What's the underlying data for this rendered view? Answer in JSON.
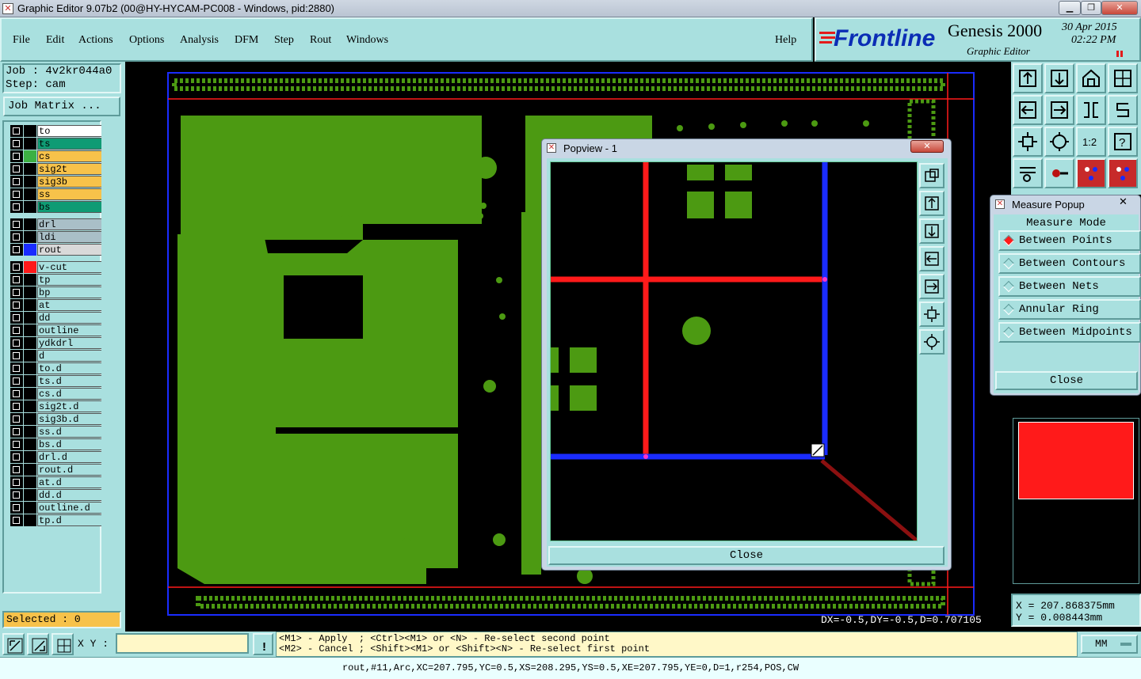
{
  "window": {
    "title": "Graphic Editor 9.07b2 (00@HY-HYCAM-PC008 - Windows, pid:2880)"
  },
  "menu": {
    "file": "File",
    "edit": "Edit",
    "actions": "Actions",
    "options": "Options",
    "analysis": "Analysis",
    "dfm": "DFM",
    "step": "Step",
    "rout": "Rout",
    "windows": "Windows",
    "help": "Help"
  },
  "brand": {
    "logo": "Frontline",
    "product": "Genesis 2000",
    "subtitle": "Graphic Editor",
    "date": "30 Apr 2015",
    "time": "02:22 PM"
  },
  "job": {
    "job_label": "Job : 4v2kr044a0",
    "step_label": "Step: cam",
    "matrix_button": "Job Matrix ..."
  },
  "layers": [
    {
      "name": "to",
      "bg": "#ffffff",
      "swatch": "#000000"
    },
    {
      "name": "ts",
      "bg": "#0f9b74",
      "swatch": "#000000"
    },
    {
      "name": "cs",
      "bg": "#f7c24a",
      "swatch": "#3cb043"
    },
    {
      "name": "sig2t",
      "bg": "#f7c24a",
      "swatch": "#000000"
    },
    {
      "name": "sig3b",
      "bg": "#f7c24a",
      "swatch": "#000000"
    },
    {
      "name": "ss",
      "bg": "#f7c24a",
      "swatch": "#000000"
    },
    {
      "name": "bs",
      "bg": "#0f9b74",
      "swatch": "#000000"
    },
    {
      "name": "drl",
      "bg": "#a9bfc7",
      "swatch": "#000000"
    },
    {
      "name": "ldi",
      "bg": "#a9bfc7",
      "swatch": "#000000"
    },
    {
      "name": "rout",
      "bg": "#d9d9d9",
      "swatch": "#1a2cff"
    },
    {
      "name": "v-cut",
      "bg": "#a9e0df",
      "swatch": "#ff1a1a"
    },
    {
      "name": "tp",
      "bg": "#a9e0df",
      "swatch": "#000000"
    },
    {
      "name": "bp",
      "bg": "#a9e0df",
      "swatch": "#000000"
    },
    {
      "name": "at",
      "bg": "#a9e0df",
      "swatch": "#000000"
    },
    {
      "name": "dd",
      "bg": "#a9e0df",
      "swatch": "#000000"
    },
    {
      "name": "outline",
      "bg": "#a9e0df",
      "swatch": "#000000"
    },
    {
      "name": "ydkdrl",
      "bg": "#a9e0df",
      "swatch": "#000000"
    },
    {
      "name": "d",
      "bg": "#a9e0df",
      "swatch": "#000000"
    },
    {
      "name": "to.d",
      "bg": "#a9e0df",
      "swatch": "#000000"
    },
    {
      "name": "ts.d",
      "bg": "#a9e0df",
      "swatch": "#000000"
    },
    {
      "name": "cs.d",
      "bg": "#a9e0df",
      "swatch": "#000000"
    },
    {
      "name": "sig2t.d",
      "bg": "#a9e0df",
      "swatch": "#000000"
    },
    {
      "name": "sig3b.d",
      "bg": "#a9e0df",
      "swatch": "#000000"
    },
    {
      "name": "ss.d",
      "bg": "#a9e0df",
      "swatch": "#000000"
    },
    {
      "name": "bs.d",
      "bg": "#a9e0df",
      "swatch": "#000000"
    },
    {
      "name": "drl.d",
      "bg": "#a9e0df",
      "swatch": "#000000"
    },
    {
      "name": "rout.d",
      "bg": "#a9e0df",
      "swatch": "#000000"
    },
    {
      "name": "at.d",
      "bg": "#a9e0df",
      "swatch": "#000000"
    },
    {
      "name": "dd.d",
      "bg": "#a9e0df",
      "swatch": "#000000"
    },
    {
      "name": "outline.d",
      "bg": "#a9e0df",
      "swatch": "#000000"
    },
    {
      "name": "tp.d",
      "bg": "#a9e0df",
      "swatch": "#000000"
    }
  ],
  "selected": "Selected : 0",
  "popview": {
    "title": "Popview - 1",
    "close": "Close"
  },
  "measure": {
    "title": "Measure Popup",
    "header": "Measure Mode",
    "options": [
      "Between Points",
      "Between Contours",
      "Between Nets",
      "Annular Ring",
      "Between Midpoints"
    ],
    "selected_index": 0,
    "close": "Close"
  },
  "readout": {
    "dxdy": "DX=-0.5,DY=-0.5,D=0.707105",
    "x": "X = 207.868375mm",
    "y": "Y = 0.008443mm"
  },
  "bottom": {
    "xy_label": "X Y :",
    "xy_value": "",
    "hint1": "<M1> - Apply  ; <Ctrl><M1> or <N> - Re-select second point",
    "hint2": "<M2> - Cancel ; <Shift><M1> or <Shift><N> - Re-select first point",
    "units": "MM",
    "status": "rout,#11,Arc,XC=207.795,YC=0.5,XS=208.295,YS=0.5,XE=207.795,YE=0,D=1,r254,POS,CW"
  },
  "colors": {
    "panel": "#a9e0df",
    "board": "#4c9a12",
    "red": "#ff1a1a",
    "blue": "#1a2cff",
    "selected": "#f7c24a"
  }
}
